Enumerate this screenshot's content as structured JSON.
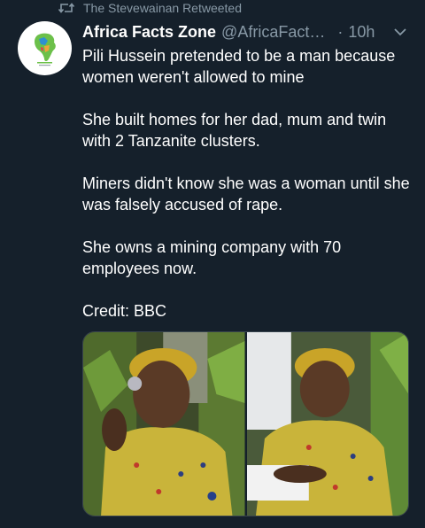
{
  "retweet": {
    "label": "The Stevewainan Retweeted",
    "icon": "retweet-icon"
  },
  "author": {
    "name": "Africa Facts Zone",
    "handle": "@AfricaFact…",
    "separator": "·",
    "time": "10h",
    "avatar_icon": "africa-map-logo-icon"
  },
  "tweet": {
    "paragraphs": [
      "Pili Hussein pretended to be a man because women weren't allowed to mine",
      "She built homes for her dad, mum and twin with 2 Tanzanite clusters.",
      "Miners didn't know she was a woman until she was falsely accused of rape.",
      "She owns a mining company with 70 employees now.",
      "Credit: BBC"
    ]
  },
  "media": {
    "photos": [
      {
        "name": "photo-woman-holding-gemstone"
      },
      {
        "name": "photo-woman-seated"
      }
    ]
  },
  "colors": {
    "background": "#15202b",
    "secondary_text": "#8899a6",
    "border": "#38444d"
  }
}
